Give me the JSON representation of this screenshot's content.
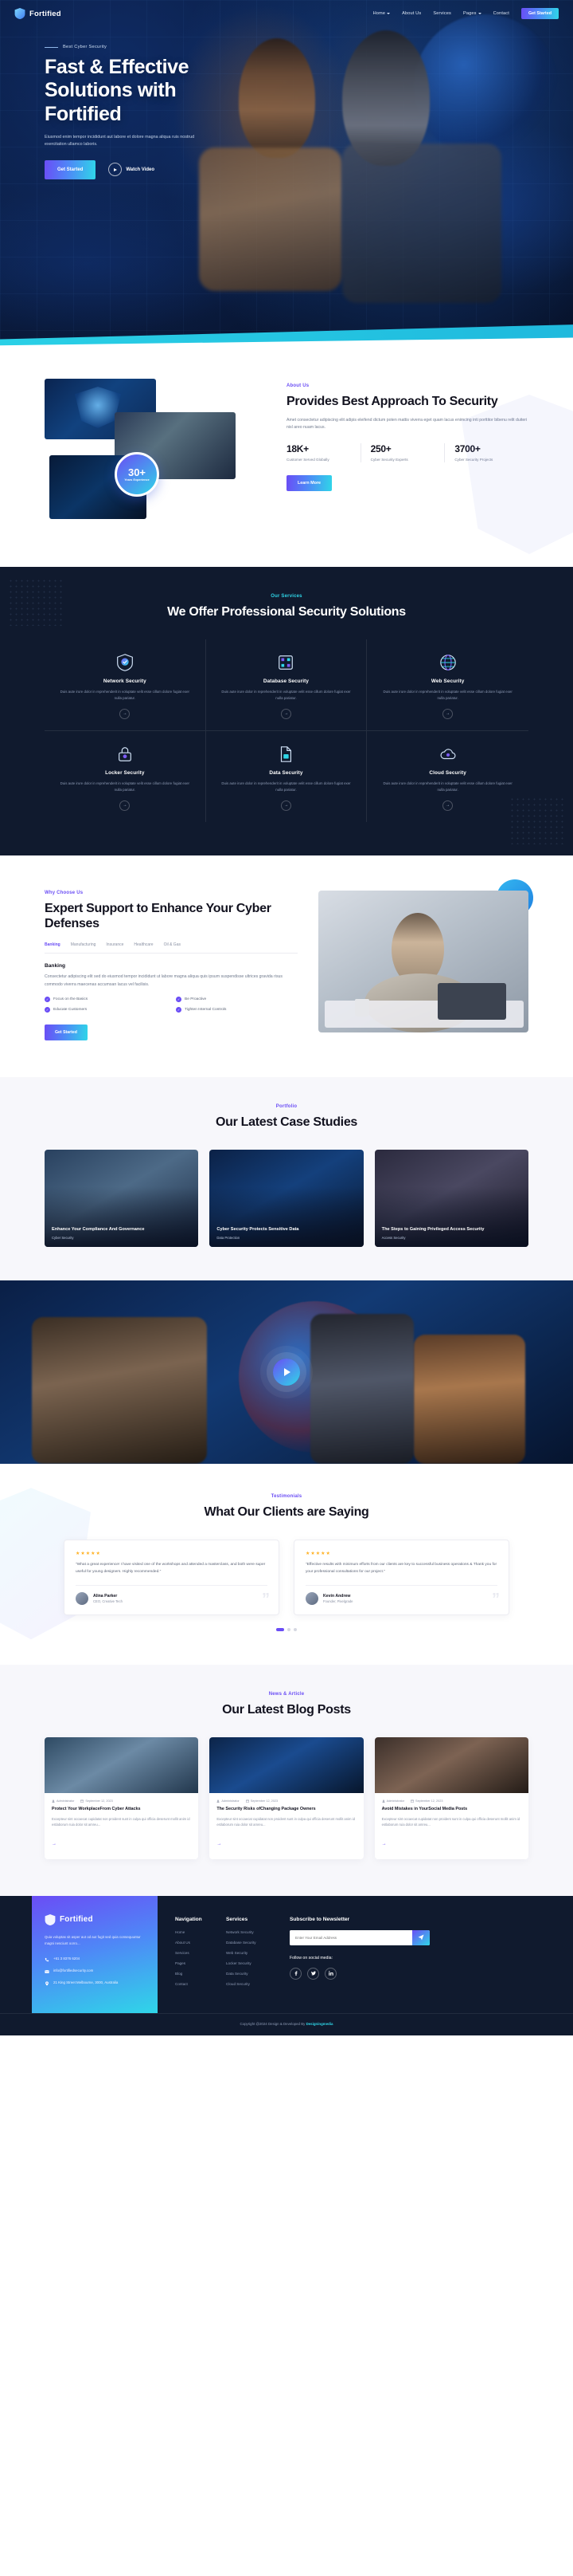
{
  "brand": {
    "name": "Fortified",
    "logo_icon": "shield-icon"
  },
  "nav": {
    "items": [
      {
        "label": "Home",
        "has_dropdown": true
      },
      {
        "label": "About Us",
        "has_dropdown": false
      },
      {
        "label": "Services",
        "has_dropdown": false
      },
      {
        "label": "Pages",
        "has_dropdown": true
      },
      {
        "label": "Contact",
        "has_dropdown": false
      }
    ],
    "cta": "Get Started"
  },
  "hero": {
    "eyebrow": "Best Cyber Security",
    "title": "Fast & Effective Solutions with Fortified",
    "description": "Eiusmod enim tempor incididunt aut labore et dolore magna aliqua ruis nostrud exercitation ullamco laboris.",
    "cta_primary": "Get Started",
    "cta_secondary": "Watch Video"
  },
  "about": {
    "tagline": "About Us",
    "title": "Provides Best Approach To Security",
    "description": "Amet consectetur adipiscing elit adipis eleifend dictum poten mattis viverra eget quam lacus enimcing inti porttitor bibenu relit duiteri nisl areo nuam lacus.",
    "badge_number": "30+",
    "badge_label": "Years Experience",
    "stats": [
      {
        "value": "18K+",
        "label": "Customer Served Globally"
      },
      {
        "value": "250+",
        "label": "Cyber Security Experts"
      },
      {
        "value": "3700+",
        "label": "Cyber Security Projects"
      }
    ],
    "cta": "Learn More"
  },
  "services": {
    "tagline": "Our Services",
    "title": "We Offer Professional Security Solutions",
    "items": [
      {
        "icon": "shield-check-icon",
        "title": "Network Security",
        "text": "Duis aute irure dolor in reprehenderit in voluptate velit esse cillum dolore fugiat exer nulla pariatur."
      },
      {
        "icon": "database-icon",
        "title": "Database Security",
        "text": "Duis aute irure dolor in reprehenderit in voluptate velit esse cillum dolore fugiat exer nulla pariatur."
      },
      {
        "icon": "globe-icon",
        "title": "Web Security",
        "text": "Duis aute irure dolor in reprehenderit in voluptate velit esse cillum dolore fugiat exer nulla pariatur."
      },
      {
        "icon": "lock-icon",
        "title": "Locker Security",
        "text": "Duis aute irure dolor in reprehenderit in voluptate velit esse cillum dolore fugiat exer nulla pariatur."
      },
      {
        "icon": "file-lock-icon",
        "title": "Data Security",
        "text": "Duis aute irure dolor in reprehenderit in voluptate velit esse cillum dolore fugiat exer nulla pariatur."
      },
      {
        "icon": "cloud-icon",
        "title": "Cloud Security",
        "text": "Duis aute irure dolor in reprehenderit in voluptate velit esse cillum dolore fugiat exer nulla pariatur."
      }
    ],
    "arrow": "→"
  },
  "why": {
    "tagline": "Why Choose Us",
    "title": "Expert Support to Enhance Your Cyber Defenses",
    "tabs": [
      "Banking",
      "Manufacturing",
      "Insurance",
      "Healthcare",
      "Oil & Gas"
    ],
    "active_tab": "Banking",
    "subtitle": "Banking",
    "description": "Consectetur adipiscing elit sed do eiusmod tempor incididunt ut labore magna aliqua quis ipsum suspendisse ultrices gravida risus commodo viverra maecenas accumsan lacus vel facilisis.",
    "checks": [
      "Focus on the Basics",
      "Be Proactive",
      "Educate Customers",
      "Tighten Internal Controls"
    ],
    "cta": "Get Started"
  },
  "portfolio": {
    "tagline": "Portfolio",
    "title": "Our Latest Case Studies",
    "cases": [
      {
        "title": "Enhance Your Compliance And Governance",
        "subtitle": "Cyber Security"
      },
      {
        "title": "Cyber Security Protects Sensitive Data",
        "subtitle": "Data Protection"
      },
      {
        "title": "The Steps to Gaining Privileged Access Security",
        "subtitle": "Access Security"
      }
    ]
  },
  "video": {
    "play_label": "play-button"
  },
  "testimonials": {
    "tagline": "Testimonials",
    "title": "What Our Clients are Saying",
    "items": [
      {
        "stars": "★★★★★",
        "text": "\"What a great experience! I have visited one of the workshops and attended a masterclass, and both were super useful for young designers. Highly recommended.\"",
        "name": "Alina Parker",
        "role": "CEO, Creative Tech"
      },
      {
        "stars": "★★★★★",
        "text": "\"Effective results with minimum efforts from our clients are key to successful business operations & Thank you for your professional consultations for our project.\"",
        "name": "Kevin Andrew",
        "role": "Founder, Pixelgrade"
      }
    ],
    "dots": 3,
    "active_dot": 0
  },
  "blog": {
    "tagline": "News & Article",
    "title": "Our Latest Blog Posts",
    "posts": [
      {
        "author": "Administrator",
        "date": "September 12, 2023",
        "title": "Protect Your WorkplaceFrom Cyber Attacks",
        "excerpt": "Excepteur sint occaecat cupidatat non proident sunt in culpa qui officia deserunt mollit anim id estlaborum ruia dolor sit amreu..."
      },
      {
        "author": "Administrator",
        "date": "September 12, 2023",
        "title": "The Security Risks ofChanging Package Owners",
        "excerpt": "Excepteur sint occaecat cupidatat non proident sunt in culpa qui officia deserunt mollit anim id estlaborum ruia dolor sit amreu..."
      },
      {
        "author": "Administrator",
        "date": "September 12, 2023",
        "title": "Avoid Mistakes in YourSocial Media Posts",
        "excerpt": "Excepteur sint occaecat cupidatat non proident sunt in culpa qui officia deserunt mollit anim id estlaborum ruia dolor sit amreu..."
      }
    ],
    "read_more_icon": "→"
  },
  "footer": {
    "brand": "Fortified",
    "description": "Quia voluptas sit asper aut od aut fugit sed quia consequuntur magni nesciunt oorro...",
    "phone": "+61 3 8376 6204",
    "email": "info@fortifiedsecurity.com",
    "address": "21 King Street Melbourne, 3000, Australia",
    "nav_heading": "Navigation",
    "nav_links": [
      "Home",
      "About Us",
      "Services",
      "Pages",
      "Blog",
      "Contact"
    ],
    "services_heading": "Services",
    "services_links": [
      "Network Security",
      "Database Security",
      "Web Security",
      "Locker Security",
      "Data Security",
      "Cloud Security"
    ],
    "newsletter_heading": "Subscribe to Newsletter",
    "newsletter_placeholder": "Enter Your Email Address",
    "newsletter_value": "",
    "follow_label": "Follow on social media:",
    "socials": [
      "facebook-icon",
      "twitter-icon",
      "linkedin-icon"
    ],
    "copyright_prefix": "Copyright @2024 Design & Developed By ",
    "copyright_brand": "Designingmedia"
  }
}
